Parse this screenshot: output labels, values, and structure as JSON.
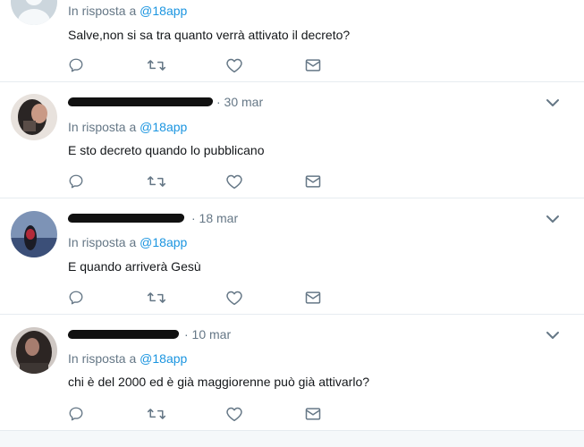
{
  "tweets": [
    {
      "name": "",
      "date": "",
      "reply_prefix": "In risposta a",
      "reply_handle": "@18app",
      "text": "Salve,non si sa tra quanto verrà attivato il decreto?",
      "icons": [
        "reply-icon",
        "retweet-icon",
        "like-icon",
        "message-icon"
      ]
    },
    {
      "name": "",
      "date": "· 30 mar",
      "reply_prefix": "In risposta a",
      "reply_handle": "@18app",
      "text": "E sto decreto quando lo pubblicano",
      "icons": [
        "reply-icon",
        "retweet-icon",
        "like-icon",
        "message-icon"
      ]
    },
    {
      "name": "",
      "date": "· 18 mar",
      "reply_prefix": "In risposta a",
      "reply_handle": "@18app",
      "text": "E quando arriverà Gesù",
      "icons": [
        "reply-icon",
        "retweet-icon",
        "like-icon",
        "message-icon"
      ]
    },
    {
      "name": "",
      "date": "· 10 mar",
      "reply_prefix": "In risposta a",
      "reply_handle": "@18app",
      "text": "chi è del 2000 ed è già maggiorenne può già attivarlo?",
      "icons": [
        "reply-icon",
        "retweet-icon",
        "like-icon",
        "message-icon"
      ]
    }
  ],
  "colors": {
    "link": "#1b95e0",
    "muted": "#657786",
    "text": "#14171a",
    "divider": "#e6ecf0"
  }
}
